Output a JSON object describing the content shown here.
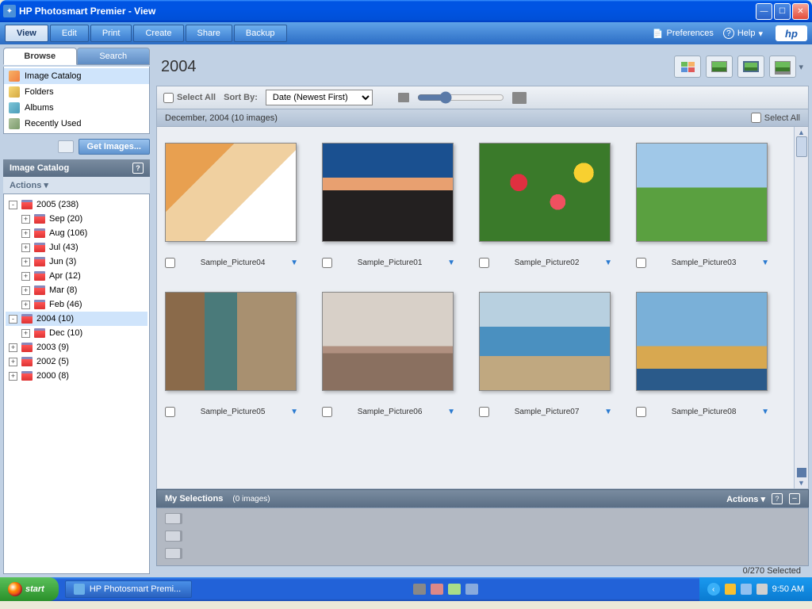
{
  "window": {
    "title": "HP Photosmart Premier - View"
  },
  "menu": {
    "items": [
      "View",
      "Edit",
      "Print",
      "Create",
      "Share",
      "Backup"
    ],
    "active": 0,
    "preferences": "Preferences",
    "help": "Help",
    "logo": "hp"
  },
  "subtabs": {
    "browse": "Browse",
    "search": "Search"
  },
  "browse_items": [
    {
      "label": "Image Catalog",
      "icon": "ic-catalog",
      "selected": true
    },
    {
      "label": "Folders",
      "icon": "ic-folders",
      "selected": false
    },
    {
      "label": "Albums",
      "icon": "ic-albums",
      "selected": false
    },
    {
      "label": "Recently Used",
      "icon": "ic-recent",
      "selected": false
    }
  ],
  "get_images": "Get Images...",
  "panel": {
    "title": "Image Catalog",
    "actions": "Actions  ▾"
  },
  "tree": [
    {
      "level": 0,
      "toggle": "-",
      "label": "2005 (238)"
    },
    {
      "level": 1,
      "toggle": "+",
      "label": "Sep (20)"
    },
    {
      "level": 1,
      "toggle": "+",
      "label": "Aug (106)"
    },
    {
      "level": 1,
      "toggle": "+",
      "label": "Jul (43)"
    },
    {
      "level": 1,
      "toggle": "+",
      "label": "Jun (3)"
    },
    {
      "level": 1,
      "toggle": "+",
      "label": "Apr (12)"
    },
    {
      "level": 1,
      "toggle": "+",
      "label": "Mar (8)"
    },
    {
      "level": 1,
      "toggle": "+",
      "label": "Feb (46)"
    },
    {
      "level": 0,
      "toggle": "-",
      "label": "2004 (10)",
      "selected": true
    },
    {
      "level": 1,
      "toggle": "+",
      "label": "Dec (10)"
    },
    {
      "level": 0,
      "toggle": "+",
      "label": "2003 (9)"
    },
    {
      "level": 0,
      "toggle": "+",
      "label": "2002 (5)"
    },
    {
      "level": 0,
      "toggle": "+",
      "label": "2000 (8)"
    }
  ],
  "content": {
    "year": "2004",
    "select_all": "Select All",
    "sort_by": "Sort By:",
    "sort_value": "Date (Newest First)",
    "group_header": "December, 2004 (10 images)",
    "group_select_all": "Select All"
  },
  "thumbs": [
    {
      "name": "Sample_Picture04",
      "cls": "pic1"
    },
    {
      "name": "Sample_Picture01",
      "cls": "pic2"
    },
    {
      "name": "Sample_Picture02",
      "cls": "pic3"
    },
    {
      "name": "Sample_Picture03",
      "cls": "pic4"
    },
    {
      "name": "Sample_Picture05",
      "cls": "pic5"
    },
    {
      "name": "Sample_Picture06",
      "cls": "pic6"
    },
    {
      "name": "Sample_Picture07",
      "cls": "pic7"
    },
    {
      "name": "Sample_Picture08",
      "cls": "pic8"
    }
  ],
  "selections": {
    "title": "My Selections",
    "count": "(0 images)",
    "actions": "Actions  ▾"
  },
  "status": "0/270 Selected",
  "taskbar": {
    "start": "start",
    "task": "HP Photosmart Premi...",
    "time": "9:50 AM"
  }
}
